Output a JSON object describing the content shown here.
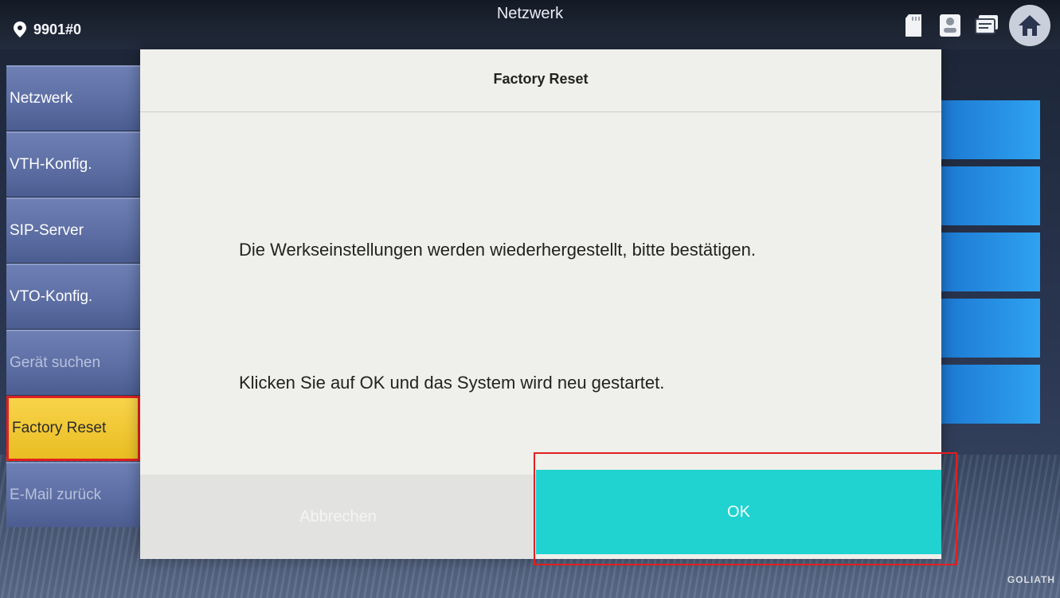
{
  "header": {
    "device_id": "9901#0",
    "title": "Netzwerk"
  },
  "status_icons": [
    "sd-card-icon",
    "contact-icon",
    "message-icon"
  ],
  "sidebar": {
    "items": [
      {
        "label": "Netzwerk"
      },
      {
        "label": "VTH-Konfig."
      },
      {
        "label": "SIP-Server"
      },
      {
        "label": "VTO-Konfig."
      },
      {
        "label": "Gerät suchen"
      },
      {
        "label": "Factory Reset",
        "active": true
      },
      {
        "label": "E-Mail zurück"
      }
    ]
  },
  "dialog": {
    "title": "Factory Reset",
    "message1": "Die Werkseinstellungen werden wiederhergestellt, bitte bestätigen.",
    "message2": "Klicken Sie auf OK und das System wird neu gestartet.",
    "cancel_label": "Abbrechen",
    "ok_label": "OK"
  },
  "watermark": "GOLIATH",
  "colors": {
    "accent": "#20d3d1",
    "highlight": "#e02020",
    "sidebar_active": "#f2c834"
  }
}
